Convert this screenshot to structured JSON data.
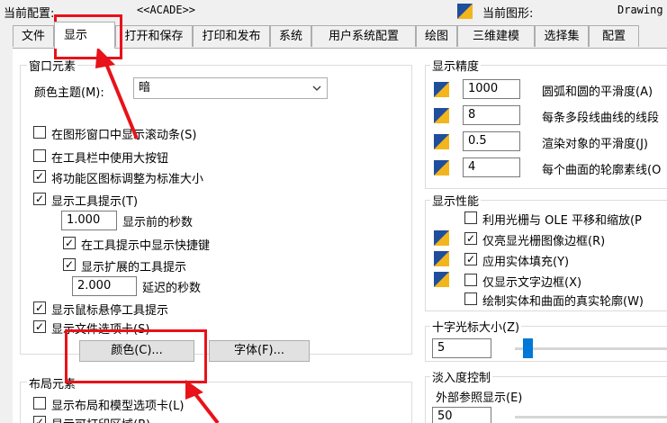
{
  "header": {
    "profile_label": "当前配置:",
    "profile_value": "<<ACADE>>",
    "drawing_label": "当前图形:",
    "drawing_value": "Drawing"
  },
  "tabs": [
    {
      "label": "文件"
    },
    {
      "label": "显示"
    },
    {
      "label": "打开和保存"
    },
    {
      "label": "打印和发布"
    },
    {
      "label": "系统"
    },
    {
      "label": "用户系统配置"
    },
    {
      "label": "绘图"
    },
    {
      "label": "三维建模"
    },
    {
      "label": "选择集"
    },
    {
      "label": "配置"
    }
  ],
  "window_elements": {
    "title": "窗口元素",
    "theme_label": "颜色主题(M):",
    "theme_value": "暗",
    "checkboxes": [
      {
        "label": "在图形窗口中显示滚动条(S)",
        "checked": false
      },
      {
        "label": "在工具栏中使用大按钮",
        "checked": false
      },
      {
        "label": "将功能区图标调整为标准大小",
        "checked": true
      },
      {
        "label": "显示工具提示(T)",
        "checked": true
      },
      {
        "label": "在工具提示中显示快捷键",
        "checked": true
      },
      {
        "label": "显示扩展的工具提示",
        "checked": true
      },
      {
        "label": "显示鼠标悬停工具提示",
        "checked": true
      },
      {
        "label": "显示文件选项卡(S)",
        "checked": true
      }
    ],
    "delay_value": "1.000",
    "delay_label": "显示前的秒数",
    "ext_delay_value": "2.000",
    "ext_delay_label": "延迟的秒数",
    "color_button": "颜色(C)...",
    "font_button": "字体(F)..."
  },
  "layout_elements": {
    "title": "布局元素",
    "checkboxes": [
      {
        "label": "显示布局和模型选项卡(L)",
        "checked": false
      },
      {
        "label": "显示可打印区域(B)",
        "checked": true
      }
    ]
  },
  "display_resolution": {
    "title": "显示精度",
    "rows": [
      {
        "value": "1000",
        "label": "圆弧和圆的平滑度(A)"
      },
      {
        "value": "8",
        "label": "每条多段线曲线的线段"
      },
      {
        "value": "0.5",
        "label": "渲染对象的平滑度(J)"
      },
      {
        "value": "4",
        "label": "每个曲面的轮廓素线(O"
      }
    ]
  },
  "display_performance": {
    "title": "显示性能",
    "checkboxes": [
      {
        "label": "利用光栅与 OLE 平移和缩放(P",
        "checked": false
      },
      {
        "label": "仅亮显光栅图像边框(R)",
        "checked": true
      },
      {
        "label": "应用实体填充(Y)",
        "checked": true
      },
      {
        "label": "仅显示文字边框(X)",
        "checked": false
      },
      {
        "label": "绘制实体和曲面的真实轮廓(W)",
        "checked": false
      }
    ]
  },
  "crosshair": {
    "title": "十字光标大小(Z)",
    "value": "5",
    "slider_fraction": 0.05
  },
  "fade": {
    "title": "淡入度控制",
    "xref_label": "外部参照显示(E)",
    "xref_value": "50"
  },
  "colors": {
    "highlight": "#e8121a",
    "accent": "#0078d7"
  }
}
